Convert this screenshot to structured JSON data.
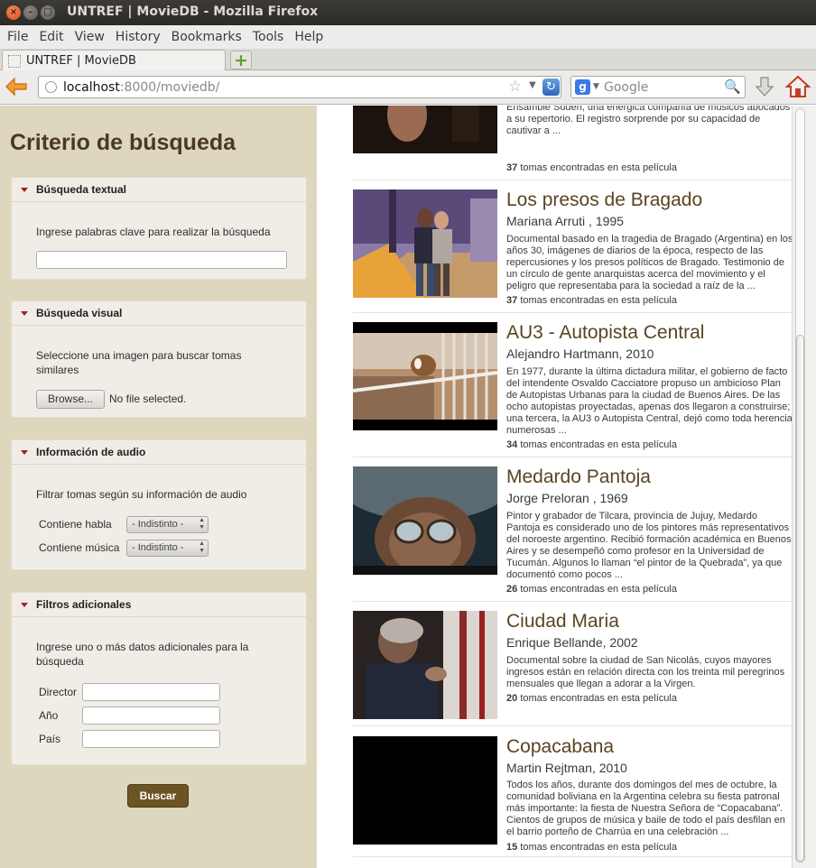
{
  "window": {
    "title": "UNTREF | MovieDB - Mozilla Firefox",
    "close_glyph": "×",
    "minimize_glyph": "–",
    "maximize_glyph": "□"
  },
  "menu": [
    "File",
    "Edit",
    "View",
    "History",
    "Bookmarks",
    "Tools",
    "Help"
  ],
  "tab": {
    "label": "UNTREF | MovieDB",
    "new_tab_glyph": "+"
  },
  "urlbar": {
    "host": "localhost",
    "rest": ":8000/moviedb/"
  },
  "searchbar": {
    "engine_glyph": "g",
    "placeholder": "Google"
  },
  "sidebar": {
    "title": "Criterio de búsqueda",
    "textual": {
      "heading": "Búsqueda textual",
      "instruction": "Ingrese palabras clave para realizar la búsqueda"
    },
    "visual": {
      "heading": "Búsqueda visual",
      "instruction": "Seleccione una imagen para buscar tomas similares",
      "browse_label": "Browse...",
      "file_status": "No file selected."
    },
    "audio": {
      "heading": "Información de audio",
      "instruction": "Filtrar tomas según su información de audio",
      "speech_label": "Contiene habla",
      "speech_value": "- Indistinto -",
      "music_label": "Contiene música",
      "music_value": "- Indistinto -"
    },
    "extra": {
      "heading": "Filtros adicionales",
      "instruction": "Ingrese uno o más datos adicionales para la búsqueda",
      "director_label": "Director",
      "year_label": "Año",
      "country_label": "País"
    },
    "search_button": "Buscar"
  },
  "results": {
    "count_suffix": "tomas encontradas en esta película",
    "top_partial": {
      "desc": "del siglo XX, vuelve por última vez a Buenos Aires después de cuarenta años. Durante una semana el maestro trabaja con el Ensamble Süden, una energica compañía de músicos abocados a su repertorio. El registro sorprende por su capacidad de cautivar a ...",
      "count": "37"
    },
    "movies": [
      {
        "title": "Los presos de Bragado",
        "sub": "Mariana Arruti , 1995",
        "desc": "Documental basado en la tragedia de Bragado (Argentina) en los años 30, imágenes de diarios de la época, respecto de las repercusiones y los presos políticos de Bragado. Testimonio de un círculo de gente anarquistas acerca del movimiento y el peligro que representaba para la sociedad a raíz de la ...",
        "count": "37"
      },
      {
        "title": "AU3 - Autopista Central",
        "sub": "Alejandro Hartmann, 2010",
        "desc": "En 1977, durante la última dictadura militar, el gobierno de facto del intendente Osvaldo Cacciatore propuso un ambicioso Plan de Autopistas Urbanas para la ciudad de Buenos Aires. De las ocho autopistas proyectadas, apenas dos llegaron a construirse; una tercera, la AU3 o Autopista Central, dejó como toda herencia numerosas ...",
        "count": "34"
      },
      {
        "title": "Medardo Pantoja",
        "sub": "Jorge Preloran , 1969",
        "desc": "Pintor y grabador de Tilcara, provincia de Jujuy, Medardo Pantoja es considerado uno de los pintores más representativos del noroeste argentino. Recibió formación académica en Buenos Aires y se desempeñó como profesor en la Universidad de Tucumán. Algunos lo llaman “el pintor de la Quebrada”, ya que documentó como pocos ...",
        "count": "26"
      },
      {
        "title": "Ciudad Maria",
        "sub": "Enrique Bellande, 2002",
        "desc": "Documental sobre la ciudad de San Nicolás, cuyos mayores ingresos están en relación directa con los treinta mil peregrinos mensuales que llegan a adorar a la Virgen.",
        "count": "20"
      },
      {
        "title": "Copacabana",
        "sub": "Martin Rejtman, 2010",
        "desc": "Todos los años, durante dos domingos del mes de octubre, la comunidad boliviana en la Argentina celebra su fiesta patronal más importante: la fiesta de Nuestra Señora de “Copacabana”. Cientos de grupos de música y baile de todo el país desfilan en el barrio porteño de Charrúa en una celebración ...",
        "count": "15"
      }
    ]
  }
}
